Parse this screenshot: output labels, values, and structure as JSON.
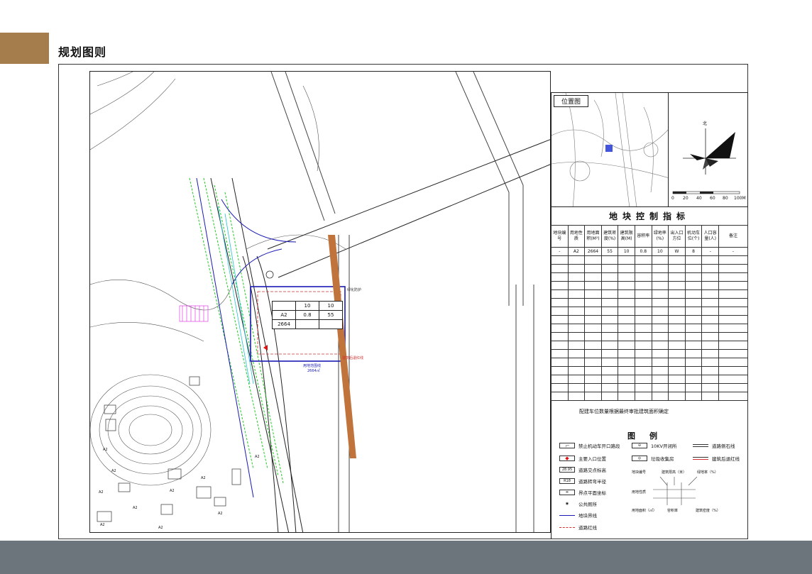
{
  "page": {
    "title": "规划图则"
  },
  "colors": {
    "accent": "#a57c4b",
    "footer": "#6c747c",
    "road_buffer": "#c0733a",
    "boundary": "#1a1ab4",
    "redline": "#d03030",
    "greens": "#22cc22",
    "magenta": "#e040e0"
  },
  "location_map": {
    "title": "位置图"
  },
  "compass": {
    "north_label": "北",
    "scale_labels": [
      "0",
      "20",
      "40",
      "60",
      "80",
      "100M"
    ]
  },
  "control_table": {
    "title": "地块控制指标",
    "headers": [
      "地块编号",
      "用地性质",
      "用地面积(M²)",
      "建筑密度(%)",
      "建筑限高(M)",
      "容积率",
      "绿地率(%)",
      "出入口方位",
      "机动车位(个)",
      "人口容量(人)",
      "备注"
    ],
    "rows": [
      [
        "-",
        "A2",
        "2664",
        "55",
        "10",
        "0.8",
        "10",
        "W",
        "8",
        "-",
        "-"
      ]
    ]
  },
  "note": "配建车位数量根据最终审批建筑面积确定",
  "legend": {
    "title": "图例",
    "items": [
      {
        "icon": "no-entry-icon",
        "label": "禁止机动车开口路段"
      },
      {
        "icon": "main-entrance-icon",
        "label": "主要入口位置"
      },
      {
        "icon": "elevation-icon",
        "label": "道路交点标高",
        "symbol": "28.95"
      },
      {
        "icon": "radius-icon",
        "label": "道路转弯半径",
        "symbol": "R18"
      },
      {
        "icon": "coordinate-icon",
        "label": "界点平面坐标"
      },
      {
        "icon": "toilet-icon",
        "label": "公共厕所"
      },
      {
        "icon": "boundary-line-icon",
        "label": "地块界线"
      },
      {
        "icon": "red-line-icon",
        "label": "道路红线"
      },
      {
        "icon": "switch-station-icon",
        "label": "10KV开闭所"
      },
      {
        "icon": "garbage-station-icon",
        "label": "垃圾收集房"
      },
      {
        "icon": "curb-line-icon",
        "label": "道路侧石线"
      },
      {
        "icon": "setback-line-icon",
        "label": "建筑后退红线"
      }
    ],
    "diagram": {
      "top_labels": [
        "地块编号",
        "建筑限高（米）",
        "绿地率（%）"
      ],
      "mid_label": "用地性质",
      "bottom_labels": [
        "用地面积（㎡）",
        "容积率",
        "建筑密度（%）"
      ]
    }
  },
  "map": {
    "block_indicators": [
      [
        "",
        "10",
        "10"
      ],
      [
        "A2",
        "0.8",
        "55"
      ],
      [
        "2664",
        "",
        ""
      ]
    ],
    "plot_boundary_label": "用地范围线",
    "plot_area": "2664㎡",
    "setback_label": "建筑后退红线",
    "road_buffer_label": "绿化防护",
    "parcel_labels": [
      "A2",
      "A2",
      "A2",
      "A2",
      "A2",
      "A2",
      "A2",
      "A2",
      "A2",
      "A2"
    ]
  }
}
